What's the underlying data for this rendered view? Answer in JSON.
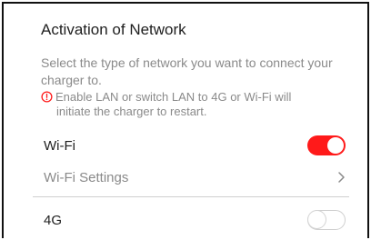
{
  "header": {
    "title": "Activation of Network"
  },
  "description": "Select the type of network you want to connect your charger to.",
  "warning": {
    "line1": "Enable LAN or switch LAN to 4G or Wi-Fi will",
    "line2": "initiate the charger to restart.",
    "icon": "warning-circle-icon",
    "color": "#ff1a1a"
  },
  "wifi": {
    "label": "Wi-Fi",
    "enabled": true
  },
  "wifi_settings": {
    "label": "Wi-Fi Settings",
    "icon": "chevron-right-icon"
  },
  "fourg": {
    "label": "4G",
    "enabled": false
  },
  "colors": {
    "accent": "#ff1a1a",
    "text_primary": "#1f1f1f",
    "text_secondary": "#8a8a8a"
  }
}
